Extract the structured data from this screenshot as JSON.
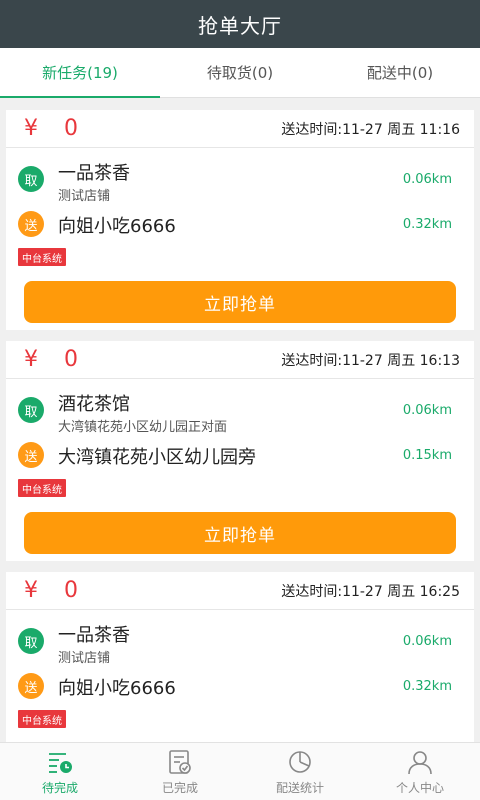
{
  "header": {
    "title": "抢单大厅"
  },
  "tabs": [
    {
      "label": "新任务(19)",
      "active": true
    },
    {
      "label": "待取货(0)",
      "active": false
    },
    {
      "label": "配送中(0)",
      "active": false
    }
  ],
  "orders": [
    {
      "currency": "¥",
      "amount": "0",
      "due_label": "送达时间:",
      "due_time": "11-27 周五 11:16",
      "pickup_badge": "取",
      "pickup_name": "一品茶香",
      "pickup_sub": "测试店铺",
      "pickup_distance": "0.06km",
      "deliver_badge": "送",
      "deliver_name": "向姐小吃6666",
      "deliver_distance": "0.32km",
      "tag": "中台系统",
      "button": "立即抢单"
    },
    {
      "currency": "¥",
      "amount": "0",
      "due_label": "送达时间:",
      "due_time": "11-27 周五 16:13",
      "pickup_badge": "取",
      "pickup_name": "酒花茶馆",
      "pickup_sub": "大湾镇花苑小区幼儿园正对面",
      "pickup_distance": "0.06km",
      "deliver_badge": "送",
      "deliver_name": "大湾镇花苑小区幼儿园旁",
      "deliver_distance": "0.15km",
      "tag": "中台系统",
      "button": "立即抢单"
    },
    {
      "currency": "¥",
      "amount": "0",
      "due_label": "送达时间:",
      "due_time": "11-27 周五 16:25",
      "pickup_badge": "取",
      "pickup_name": "一品茶香",
      "pickup_sub": "测试店铺",
      "pickup_distance": "0.06km",
      "deliver_badge": "送",
      "deliver_name": "向姐小吃6666",
      "deliver_distance": "0.32km",
      "tag": "中台系统"
    }
  ],
  "bottom_nav": [
    {
      "label": "待完成",
      "icon": "pending-list-icon",
      "active": true
    },
    {
      "label": "已完成",
      "icon": "completed-doc-icon",
      "active": false
    },
    {
      "label": "配送统计",
      "icon": "pie-chart-icon",
      "active": false
    },
    {
      "label": "个人中心",
      "icon": "user-icon",
      "active": false
    }
  ],
  "colors": {
    "accent": "#1aaa6a",
    "header": "#3a464b",
    "price": "#e8373c",
    "button": "#ff9a0a"
  }
}
